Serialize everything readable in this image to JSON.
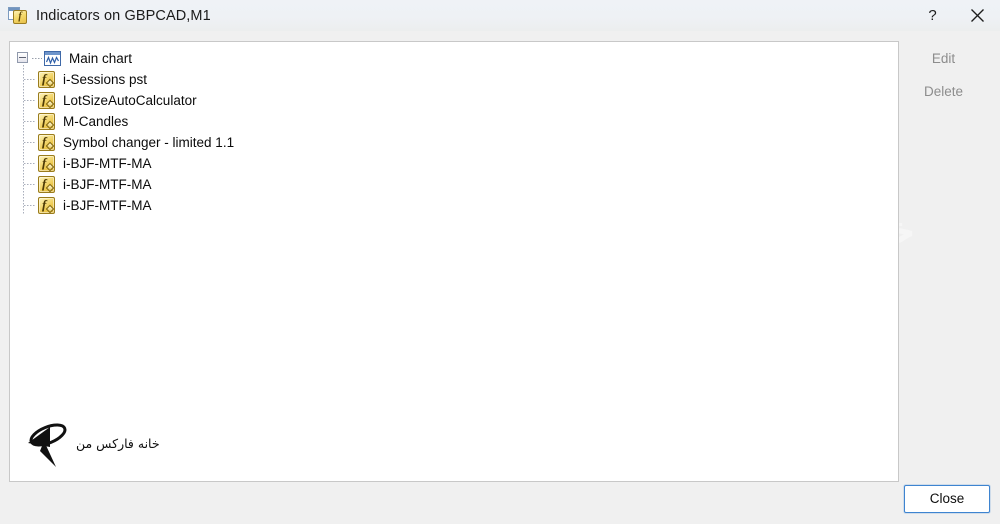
{
  "window": {
    "title": "Indicators on GBPCAD,M1",
    "icon": "indicator-window-icon",
    "icon_badge_letter": "f",
    "help_label": "?",
    "close_label": "✕",
    "bg_color": "#f0f0f0",
    "titlebar_color": "#eef1f5"
  },
  "tree": {
    "root": {
      "label": "Main chart",
      "icon": "chart-window-icon",
      "expanded": true,
      "expander_symbol": "−"
    },
    "items": [
      {
        "label": "i-Sessions pst",
        "icon": "indicator-fx-icon"
      },
      {
        "label": "LotSizeAutoCalculator",
        "icon": "indicator-fx-icon"
      },
      {
        "label": "M-Candles",
        "icon": "indicator-fx-icon"
      },
      {
        "label": "Symbol changer - limited 1.1",
        "icon": "indicator-fx-icon"
      },
      {
        "label": "i-BJF-MTF-MA",
        "icon": "indicator-fx-icon"
      },
      {
        "label": "i-BJF-MTF-MA",
        "icon": "indicator-fx-icon"
      },
      {
        "label": "i-BJF-MTF-MA",
        "icon": "indicator-fx-icon"
      }
    ],
    "icon_letter": "f"
  },
  "buttons": {
    "edit": {
      "label": "Edit",
      "enabled": false
    },
    "delete": {
      "label": "Delete",
      "enabled": false
    },
    "close": {
      "label": "Close",
      "enabled": true,
      "focus_color": "#3e84d0"
    }
  },
  "watermarks": {
    "left_text": "خانه فارکس من",
    "right_text": "خانه فارکس من",
    "logo_text": "خانه فارکس من"
  }
}
